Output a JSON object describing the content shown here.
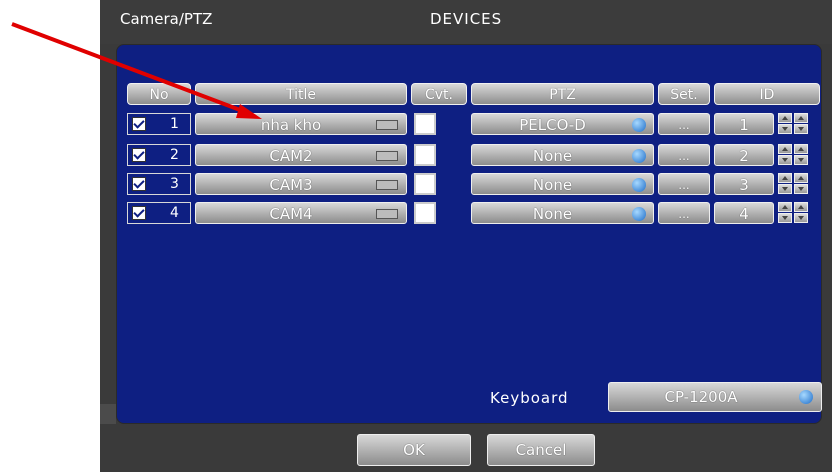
{
  "window": {
    "menu_path": "Camera/PTZ",
    "title": "DEVICES"
  },
  "table": {
    "headers": {
      "no": "No",
      "title": "Title",
      "cvt": "Cvt.",
      "ptz": "PTZ",
      "set": "Set.",
      "id": "ID"
    },
    "rows": [
      {
        "no": "1",
        "checked": true,
        "title": "nha kho",
        "cvt": false,
        "ptz": "PELCO-D",
        "set": "...",
        "id": "1"
      },
      {
        "no": "2",
        "checked": true,
        "title": "CAM2",
        "cvt": false,
        "ptz": "None",
        "set": "...",
        "id": "2"
      },
      {
        "no": "3",
        "checked": true,
        "title": "CAM3",
        "cvt": false,
        "ptz": "None",
        "set": "...",
        "id": "3"
      },
      {
        "no": "4",
        "checked": true,
        "title": "CAM4",
        "cvt": false,
        "ptz": "None",
        "set": "...",
        "id": "4"
      }
    ]
  },
  "keyboard": {
    "label": "Keyboard",
    "value": "CP-1200A"
  },
  "buttons": {
    "ok": "OK",
    "cancel": "Cancel"
  },
  "colors": {
    "panel": "#0e1f82",
    "annotation_arrow": "#e00000"
  },
  "icons": [
    "keyboard-icon",
    "globe-icon",
    "spin-up-icon",
    "spin-down-icon",
    "checkbox"
  ]
}
